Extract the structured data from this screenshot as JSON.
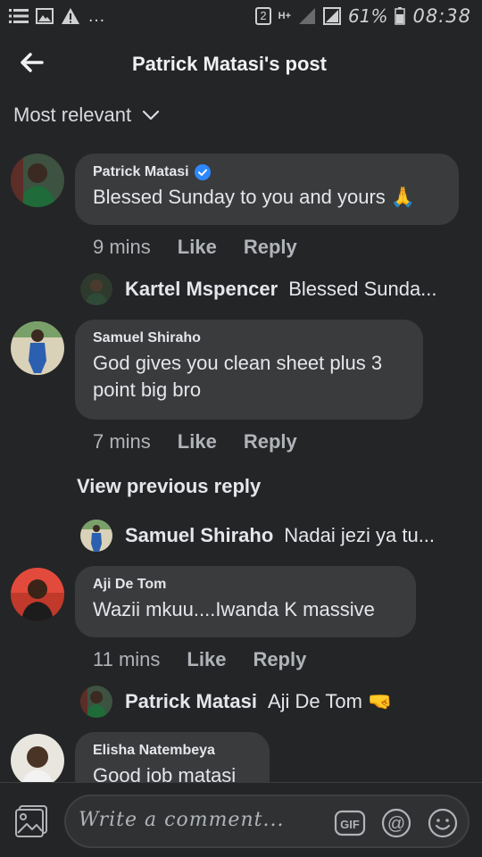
{
  "status_bar": {
    "sim_badge": "2",
    "network": "H+",
    "battery_percent": "61%",
    "time": "08:38"
  },
  "header": {
    "title": "Patrick Matasi's post"
  },
  "sort": {
    "label": "Most relevant"
  },
  "comments": [
    {
      "author": "Patrick Matasi",
      "verified": true,
      "text": "Blessed Sunday to you and yours 🙏",
      "time": "9 mins",
      "like": "Like",
      "reply": "Reply",
      "reply_preview": {
        "name": "Kartel Mspencer",
        "text": "Blessed Sunda..."
      }
    },
    {
      "author": "Samuel Shiraho",
      "text": "God gives you clean sheet plus 3 point big bro",
      "time": "7 mins",
      "like": "Like",
      "reply": "Reply",
      "view_previous": "View previous reply",
      "reply_preview": {
        "name": "Samuel Shiraho",
        "text": "Nadai jezi ya tu..."
      }
    },
    {
      "author": "Aji De Tom",
      "text": "Wazii mkuu....Iwanda K massive",
      "time": "11 mins",
      "like": "Like",
      "reply": "Reply",
      "reply_preview": {
        "name": "Patrick Matasi",
        "text": "Aji De Tom 🤜"
      }
    },
    {
      "author": "Elisha Natembeya",
      "text": "Good job matasi"
    }
  ],
  "composer": {
    "placeholder": "Write a comment...",
    "gif_label": "GIF",
    "at_label": "@"
  },
  "colors": {
    "background": "#242526",
    "bubble": "#3a3b3c",
    "text": "#e4e6eb",
    "muted": "#b0b3b8",
    "verified": "#2d88ff"
  }
}
